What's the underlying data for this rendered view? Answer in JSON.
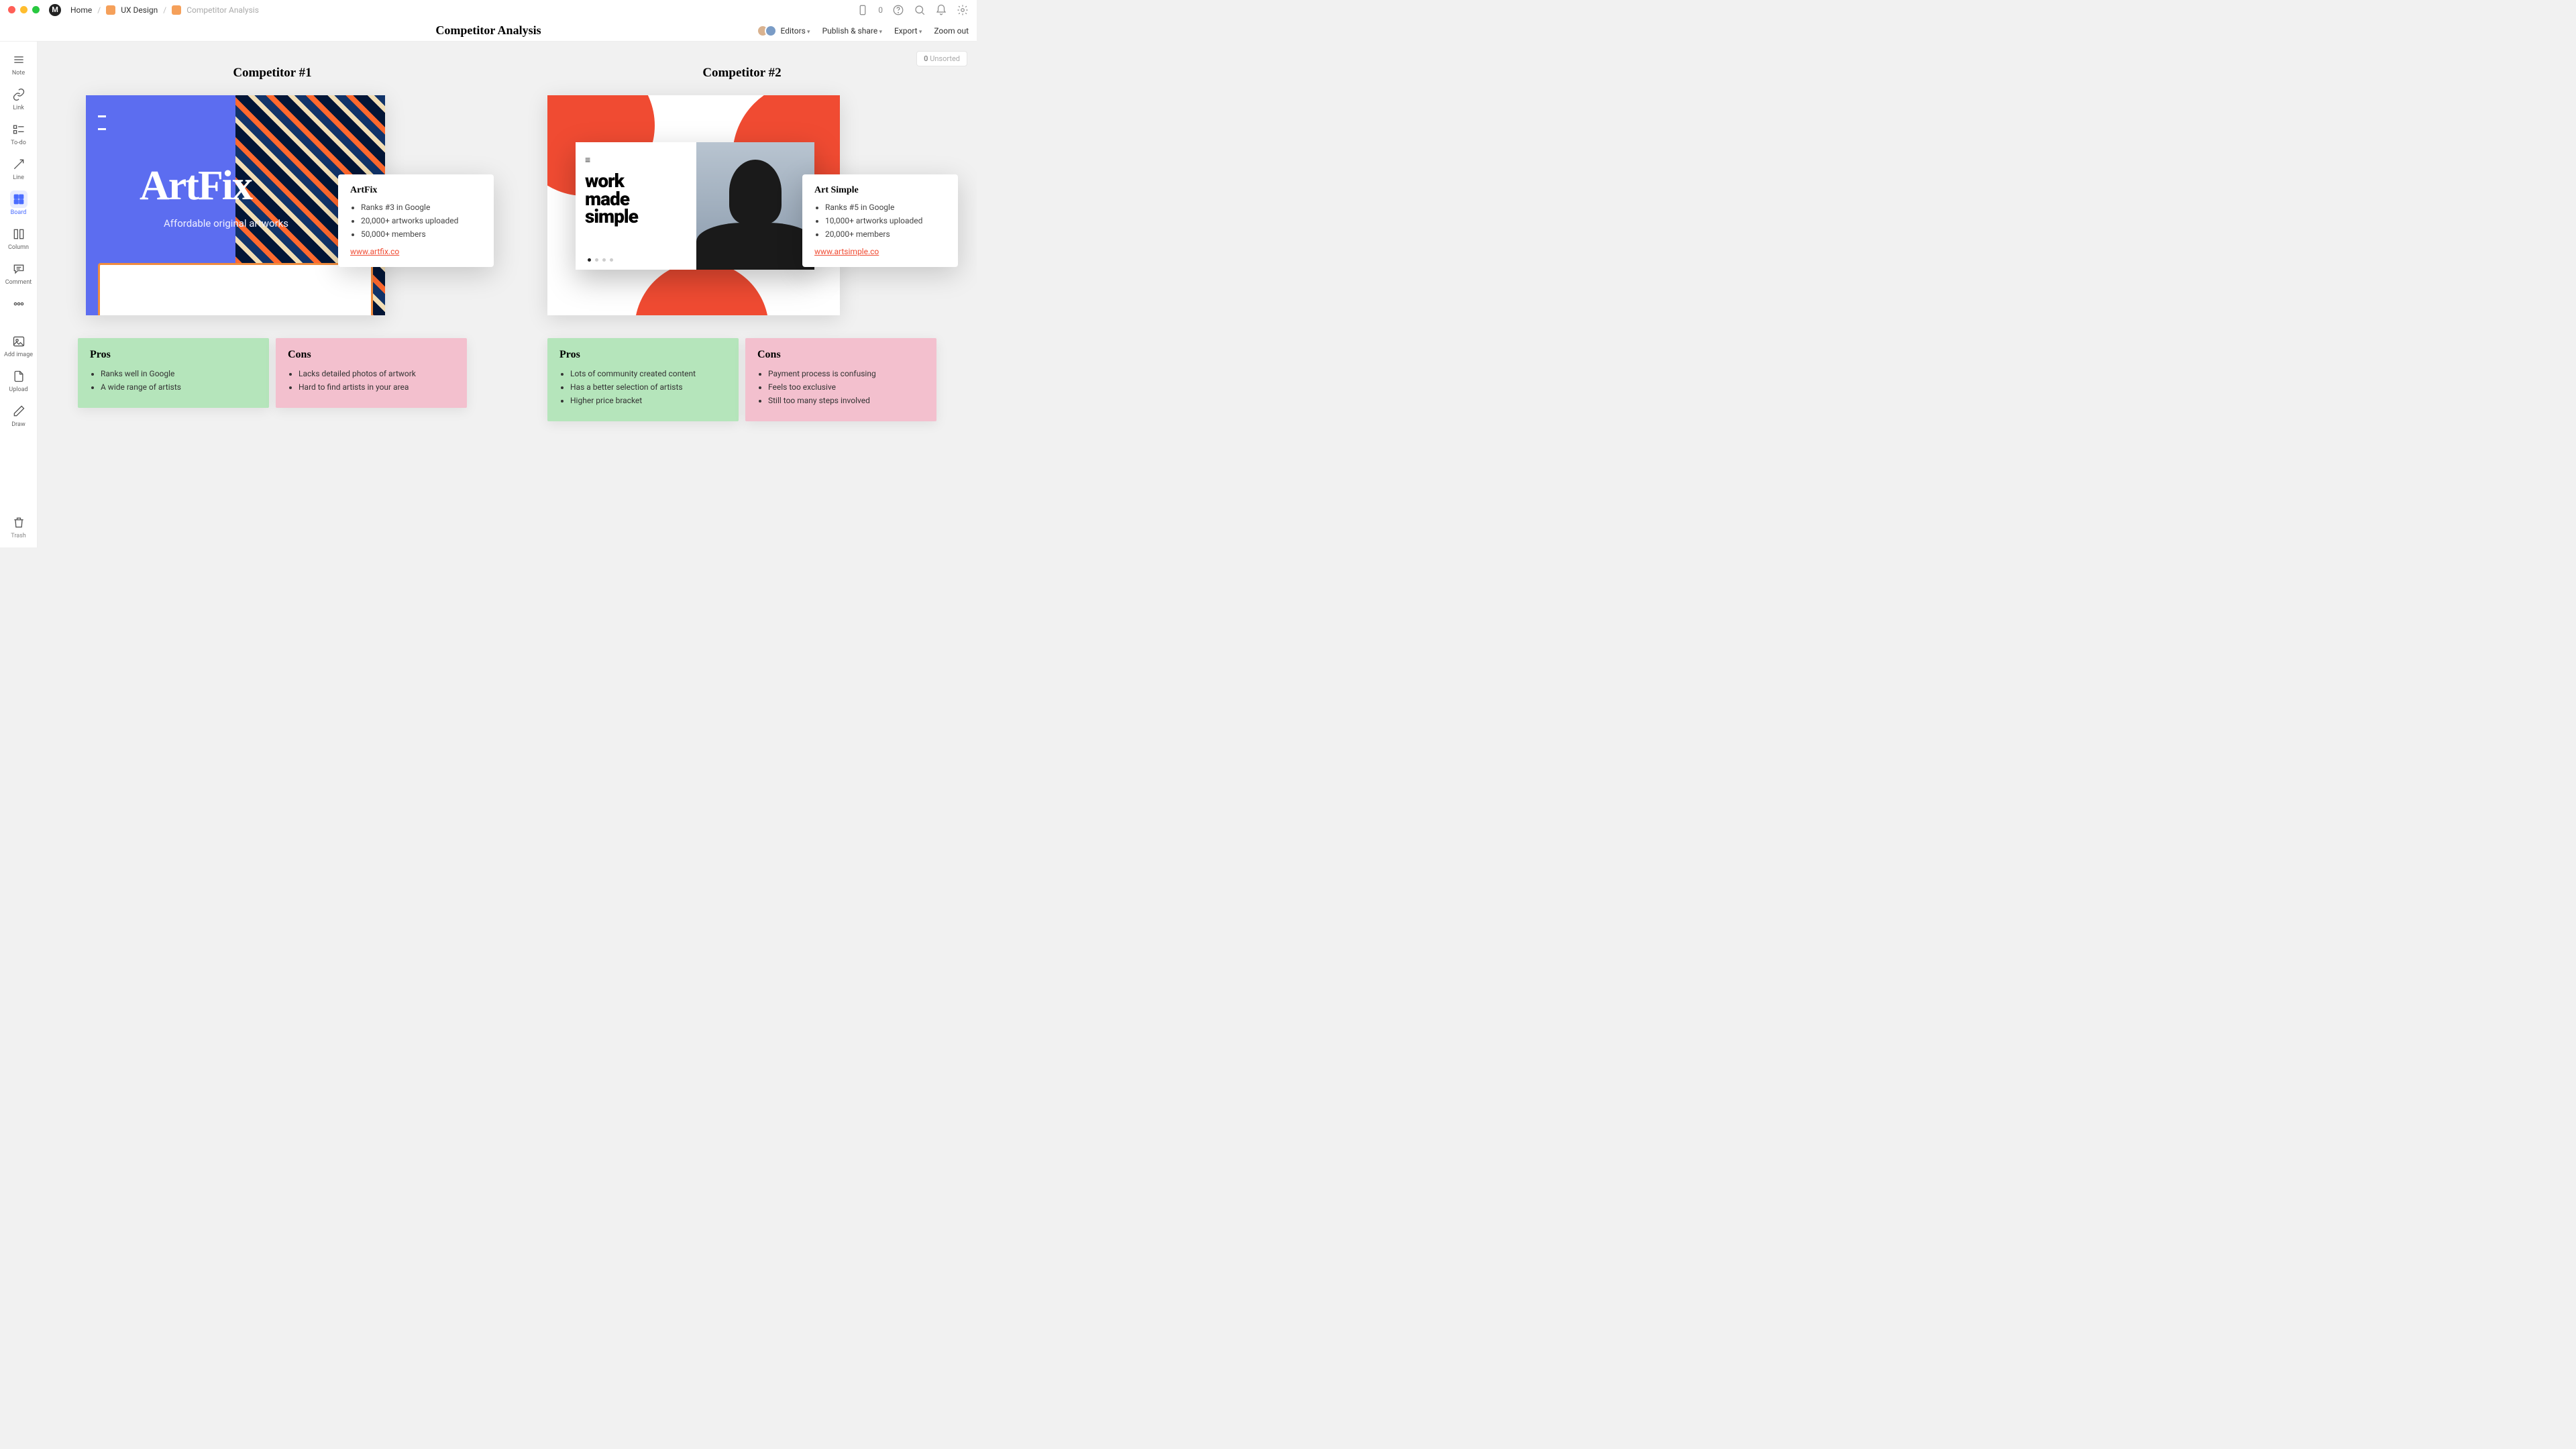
{
  "topbar": {
    "home": "Home",
    "folder1": "UX Design",
    "current": "Competitor Analysis",
    "deviceCount": "0"
  },
  "titlebar": {
    "title": "Competitor Analysis",
    "editors": "Editors",
    "publish": "Publish & share",
    "export": "Export",
    "zoom": "Zoom out"
  },
  "sidebar": {
    "note": "Note",
    "link": "Link",
    "todo": "To-do",
    "line": "Line",
    "board": "Board",
    "column": "Column",
    "comment": "Comment",
    "addimage": "Add image",
    "upload": "Upload",
    "draw": "Draw",
    "trash": "Trash"
  },
  "unsorted": {
    "count": "0",
    "label": "Unsorted"
  },
  "competitors": [
    {
      "heading": "Competitor #1",
      "brand": "ArtFix",
      "tagline": "Affordable original artworks",
      "popTitle": "ArtFix",
      "facts": [
        "Ranks #3 in Google",
        "20,000+ artworks uploaded",
        "50,000+ members"
      ],
      "link": "www.artfix.co",
      "prosTitle": "Pros",
      "pros": [
        "Ranks well in Google",
        "A wide range of artists"
      ],
      "consTitle": "Cons",
      "cons": [
        "Lacks detailed photos of artwork",
        "Hard to find artists in your area"
      ]
    },
    {
      "heading": "Competitor #2",
      "brand_l1": "work",
      "brand_l2": "made",
      "brand_l3": "simple",
      "popTitle": "Art Simple",
      "facts": [
        "Ranks #5 in Google",
        "10,000+ artworks uploaded",
        "20,000+ members"
      ],
      "link": "www.artsimple.co",
      "prosTitle": "Pros",
      "pros": [
        "Lots of community created content",
        "Has a better selection of artists",
        "Higher price bracket"
      ],
      "consTitle": "Cons",
      "cons": [
        "Payment process is confusing",
        "Feels too exclusive",
        "Still too many steps involved"
      ]
    }
  ]
}
